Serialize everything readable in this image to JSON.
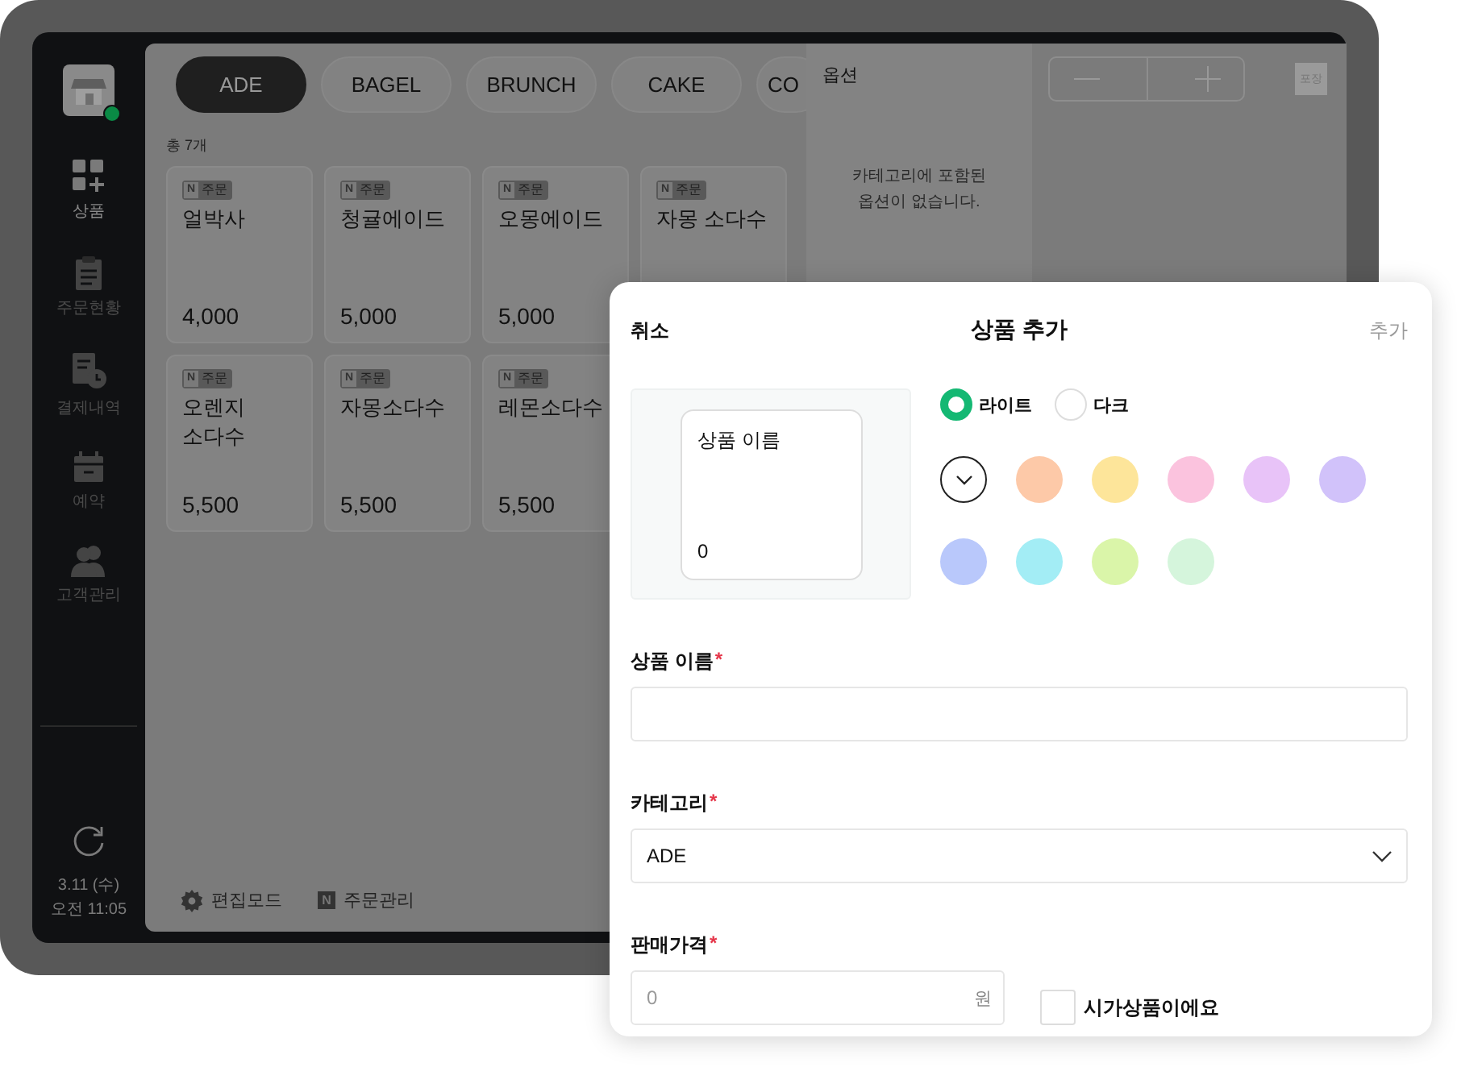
{
  "sidebar": {
    "online": true,
    "nav": [
      {
        "kind": "products",
        "label": "상품",
        "selected": true
      },
      {
        "kind": "orders",
        "label": "주문현황",
        "selected": false
      },
      {
        "kind": "payments",
        "label": "결제내역",
        "selected": false
      },
      {
        "kind": "reservations",
        "label": "예약",
        "selected": false
      },
      {
        "kind": "customers",
        "label": "고객관리",
        "selected": false
      }
    ],
    "date": "3.11 (수)",
    "time": "오전 11:05"
  },
  "categories": [
    {
      "label": "ADE",
      "selected": true
    },
    {
      "label": "BAGEL",
      "selected": false
    },
    {
      "label": "BRUNCH",
      "selected": false
    },
    {
      "label": "CAKE",
      "selected": false
    },
    {
      "label": "CO",
      "selected": false
    }
  ],
  "total": "총 7개",
  "products": [
    {
      "mark": "N",
      "badge": "주문",
      "name": "얼박사",
      "price": "4,000"
    },
    {
      "mark": "N",
      "badge": "주문",
      "name": "청귤에이드",
      "price": "5,000"
    },
    {
      "mark": "N",
      "badge": "주문",
      "name": "오몽에이드",
      "price": "5,000"
    },
    {
      "mark": "N",
      "badge": "주문",
      "name": "자몽 소다수"
    },
    {
      "mark": "N",
      "badge": "주문",
      "name": "오렌지\n소다수",
      "price": "5,500"
    },
    {
      "mark": "N",
      "badge": "주문",
      "name": "자몽소다수",
      "price": "5,500"
    },
    {
      "mark": "N",
      "badge": "주문",
      "name": "레몬소다수",
      "price": "5,500"
    }
  ],
  "toolbar": [
    {
      "kind": "settings",
      "label": "편집모드"
    },
    {
      "kind": "naver",
      "mark": "N",
      "label": "주문관리"
    }
  ],
  "options": {
    "title": "옵션",
    "empty_message": "카테고리에 포함된\n옵션이 없습니다."
  },
  "packaging_badge": "포장",
  "modal": {
    "cancel": "취소",
    "title": "상품 추가",
    "confirm": "추가",
    "preview": {
      "name": "상품 이름",
      "price": "0"
    },
    "themes": [
      {
        "label": "라이트",
        "selected": true
      },
      {
        "label": "다크",
        "selected": false
      }
    ],
    "colors": [
      {
        "color": "#ffffff",
        "selected": true
      },
      {
        "color": "#fdc9a8",
        "selected": false
      },
      {
        "color": "#fde59a",
        "selected": false
      },
      {
        "color": "#fbc3de",
        "selected": false
      },
      {
        "color": "#e8c3f8",
        "selected": false
      },
      {
        "color": "#d1c2fa",
        "selected": false
      },
      {
        "color": "#b9c8fb",
        "selected": false
      },
      {
        "color": "#a3edf5",
        "selected": false
      },
      {
        "color": "#daf5a9",
        "selected": false
      },
      {
        "color": "#d5f5dc",
        "selected": false
      }
    ],
    "name_field": {
      "label": "상품 이름",
      "required": "*"
    },
    "category_field": {
      "label": "카테고리",
      "required": "*",
      "value": "ADE"
    },
    "price_field": {
      "label": "판매가격",
      "required": "*",
      "placeholder": "0",
      "unit": "원"
    },
    "market_price": {
      "label": "시가상품이에요",
      "checked": false
    }
  }
}
